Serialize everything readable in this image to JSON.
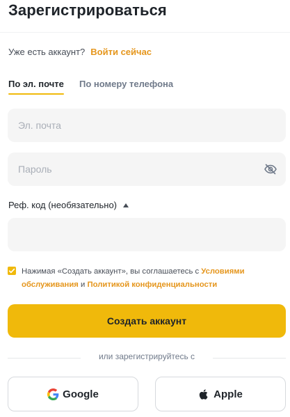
{
  "header": {
    "title": "Зарегистрироваться"
  },
  "login_prompt": {
    "text": "Уже есть аккаунт?",
    "link": "Войти сейчас"
  },
  "tabs": [
    {
      "label": "По эл. почте",
      "active": true
    },
    {
      "label": "По номеру телефона",
      "active": false
    }
  ],
  "form": {
    "email": {
      "placeholder": "Эл. почта",
      "value": ""
    },
    "password": {
      "placeholder": "Пароль",
      "value": "",
      "toggle_icon": "eye-off-icon"
    },
    "referral": {
      "label": "Реф. код (необязательно)",
      "value": "",
      "expanded": true,
      "toggle_icon": "caret-up-icon"
    }
  },
  "agreement": {
    "checked": true,
    "prefix": "Нажимая «Создать аккаунт», вы соглашаетесь с ",
    "terms_link": "Условиями обслуживания",
    "conjunction": " и ",
    "privacy_link": "Политикой конфиденциальности"
  },
  "submit": {
    "label": "Создать аккаунт"
  },
  "divider": {
    "text": "или зарегистрируйтесь с"
  },
  "social": [
    {
      "label": "Google",
      "icon": "google-icon"
    },
    {
      "label": "Apple",
      "icon": "apple-icon"
    }
  ],
  "colors": {
    "accent": "#f0b90b",
    "link": "#e5961d",
    "text": "#1e2329",
    "muted": "#707a8a",
    "field_bg": "#f5f5f5"
  }
}
